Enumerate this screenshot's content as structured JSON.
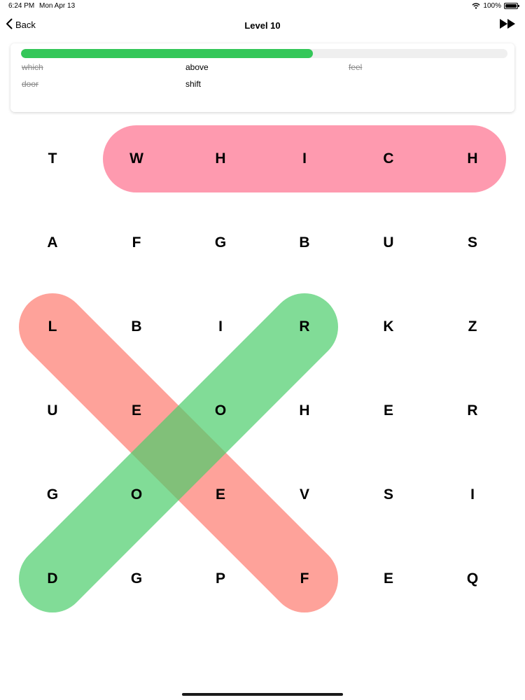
{
  "status_bar": {
    "time": "6:24 PM",
    "date": "Mon Apr 13",
    "battery": "100%"
  },
  "nav": {
    "back_label": "Back",
    "title": "Level 10",
    "back_icon": "chevron-left-icon",
    "skip_icon": "fast-forward-icon"
  },
  "progress": {
    "fraction": 0.6,
    "color": "#34c759"
  },
  "words": [
    {
      "text": "which",
      "found": true
    },
    {
      "text": "above",
      "found": false
    },
    {
      "text": "feel",
      "found": true
    },
    {
      "text": "door",
      "found": true
    },
    {
      "text": "shift",
      "found": false
    }
  ],
  "grid": {
    "rows": [
      [
        "T",
        "W",
        "H",
        "I",
        "C",
        "H"
      ],
      [
        "A",
        "F",
        "G",
        "B",
        "U",
        "S"
      ],
      [
        "L",
        "B",
        "I",
        "R",
        "K",
        "Z"
      ],
      [
        "U",
        "E",
        "O",
        "H",
        "E",
        "R"
      ],
      [
        "G",
        "O",
        "E",
        "V",
        "S",
        "I"
      ],
      [
        "D",
        "G",
        "P",
        "F",
        "E",
        "Q"
      ]
    ]
  },
  "highlights": [
    {
      "word": "which",
      "from": [
        0,
        1
      ],
      "to": [
        0,
        5
      ],
      "color": "#fe6f8d"
    },
    {
      "word": "feel",
      "from": [
        2,
        0
      ],
      "to": [
        5,
        3
      ],
      "color": "#fd7b6f"
    },
    {
      "word": "door",
      "from": [
        5,
        0
      ],
      "to": [
        2,
        3
      ],
      "color": "#4bcd6b"
    }
  ]
}
